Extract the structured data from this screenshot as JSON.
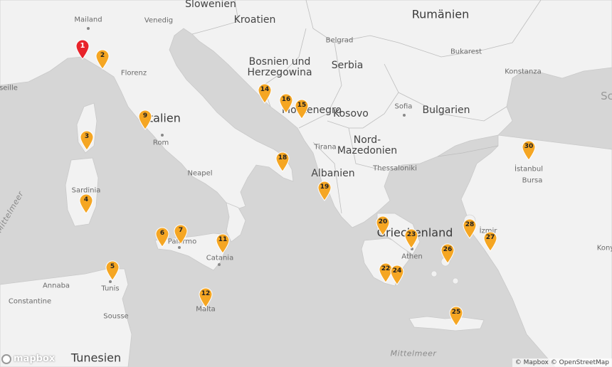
{
  "map": {
    "country_labels": [
      {
        "id": "slowenien",
        "text": "Slowenien"
      },
      {
        "id": "rumaenien",
        "text": "Rumänien"
      },
      {
        "id": "kroatien",
        "text": "Kroatien"
      },
      {
        "id": "bosnien1",
        "text": "Bosnien und"
      },
      {
        "id": "bosnien2",
        "text": "Herzegowina"
      },
      {
        "id": "serbia",
        "text": "Serbia"
      },
      {
        "id": "montenegro",
        "text": "Montenegro"
      },
      {
        "id": "kosovo",
        "text": "Kosovo"
      },
      {
        "id": "bulgarien",
        "text": "Bulgarien"
      },
      {
        "id": "nord",
        "text": "Nord-"
      },
      {
        "id": "mazedonien",
        "text": "Mazedonien"
      },
      {
        "id": "albanien",
        "text": "Albanien"
      },
      {
        "id": "italien",
        "text": "Italien"
      },
      {
        "id": "griechenland",
        "text": "Griechenland"
      },
      {
        "id": "tunesien",
        "text": "Tunesien"
      }
    ],
    "city_labels": [
      {
        "id": "mailand",
        "text": "Mailand"
      },
      {
        "id": "venedig",
        "text": "Venedig"
      },
      {
        "id": "belgrad",
        "text": "Belgrad"
      },
      {
        "id": "bukarest",
        "text": "Bukarest"
      },
      {
        "id": "konstanza",
        "text": "Konstanza"
      },
      {
        "id": "florenz",
        "text": "Florenz"
      },
      {
        "id": "seille",
        "text": "seille"
      },
      {
        "id": "sofia",
        "text": "Sofia"
      },
      {
        "id": "rom",
        "text": "Rom"
      },
      {
        "id": "tirana",
        "text": "Tirana"
      },
      {
        "id": "thessaloniki",
        "text": "Thessaloniki"
      },
      {
        "id": "istanbul",
        "text": "İstanbul"
      },
      {
        "id": "bursa",
        "text": "Bursa"
      },
      {
        "id": "neapel",
        "text": "Neapel"
      },
      {
        "id": "sardinia",
        "text": "Sardinia"
      },
      {
        "id": "palermo",
        "text": "Palermo"
      },
      {
        "id": "catania",
        "text": "Catania"
      },
      {
        "id": "athen",
        "text": "Athen"
      },
      {
        "id": "izmir",
        "text": "İzmir"
      },
      {
        "id": "annaba",
        "text": "Annaba"
      },
      {
        "id": "tunis",
        "text": "Tunis"
      },
      {
        "id": "constantine",
        "text": "Constantine"
      },
      {
        "id": "sousse",
        "text": "Sousse"
      },
      {
        "id": "malta",
        "text": "Malta"
      },
      {
        "id": "konya",
        "text": "Kony"
      },
      {
        "id": "sch",
        "text": "Sc"
      }
    ],
    "water_labels": [
      {
        "id": "mittelmeer-w",
        "text": "Mittelmeer"
      },
      {
        "id": "mittelmeer-e",
        "text": "Mittelmeer"
      }
    ],
    "markers": [
      {
        "n": "1",
        "color": "#e8232a"
      },
      {
        "n": "2",
        "color": "#f5a623"
      },
      {
        "n": "3",
        "color": "#f5a623"
      },
      {
        "n": "4",
        "color": "#f5a623"
      },
      {
        "n": "5",
        "color": "#f5a623"
      },
      {
        "n": "6",
        "color": "#f5a623"
      },
      {
        "n": "7",
        "color": "#f5a623"
      },
      {
        "n": "9",
        "color": "#f5a623"
      },
      {
        "n": "11",
        "color": "#f5a623"
      },
      {
        "n": "12",
        "color": "#f5a623"
      },
      {
        "n": "14",
        "color": "#f5a623"
      },
      {
        "n": "15",
        "color": "#f5a623"
      },
      {
        "n": "16",
        "color": "#f5a623"
      },
      {
        "n": "18",
        "color": "#f5a623"
      },
      {
        "n": "19",
        "color": "#f5a623"
      },
      {
        "n": "20",
        "color": "#f5a623"
      },
      {
        "n": "22",
        "color": "#f5a623"
      },
      {
        "n": "23",
        "color": "#f5a623"
      },
      {
        "n": "24",
        "color": "#f5a623"
      },
      {
        "n": "25",
        "color": "#f5a623"
      },
      {
        "n": "26",
        "color": "#f5a623"
      },
      {
        "n": "27",
        "color": "#f5a623"
      },
      {
        "n": "28",
        "color": "#f5a623"
      },
      {
        "n": "30",
        "color": "#f5a623"
      }
    ],
    "land_color": "#f2f2f2",
    "sea_color": "#d6d6d6",
    "border_color": "#bdbdbd"
  },
  "logo": {
    "text": "mapbox"
  },
  "attribution": {
    "text": "© Mapbox © OpenStreetMap"
  }
}
